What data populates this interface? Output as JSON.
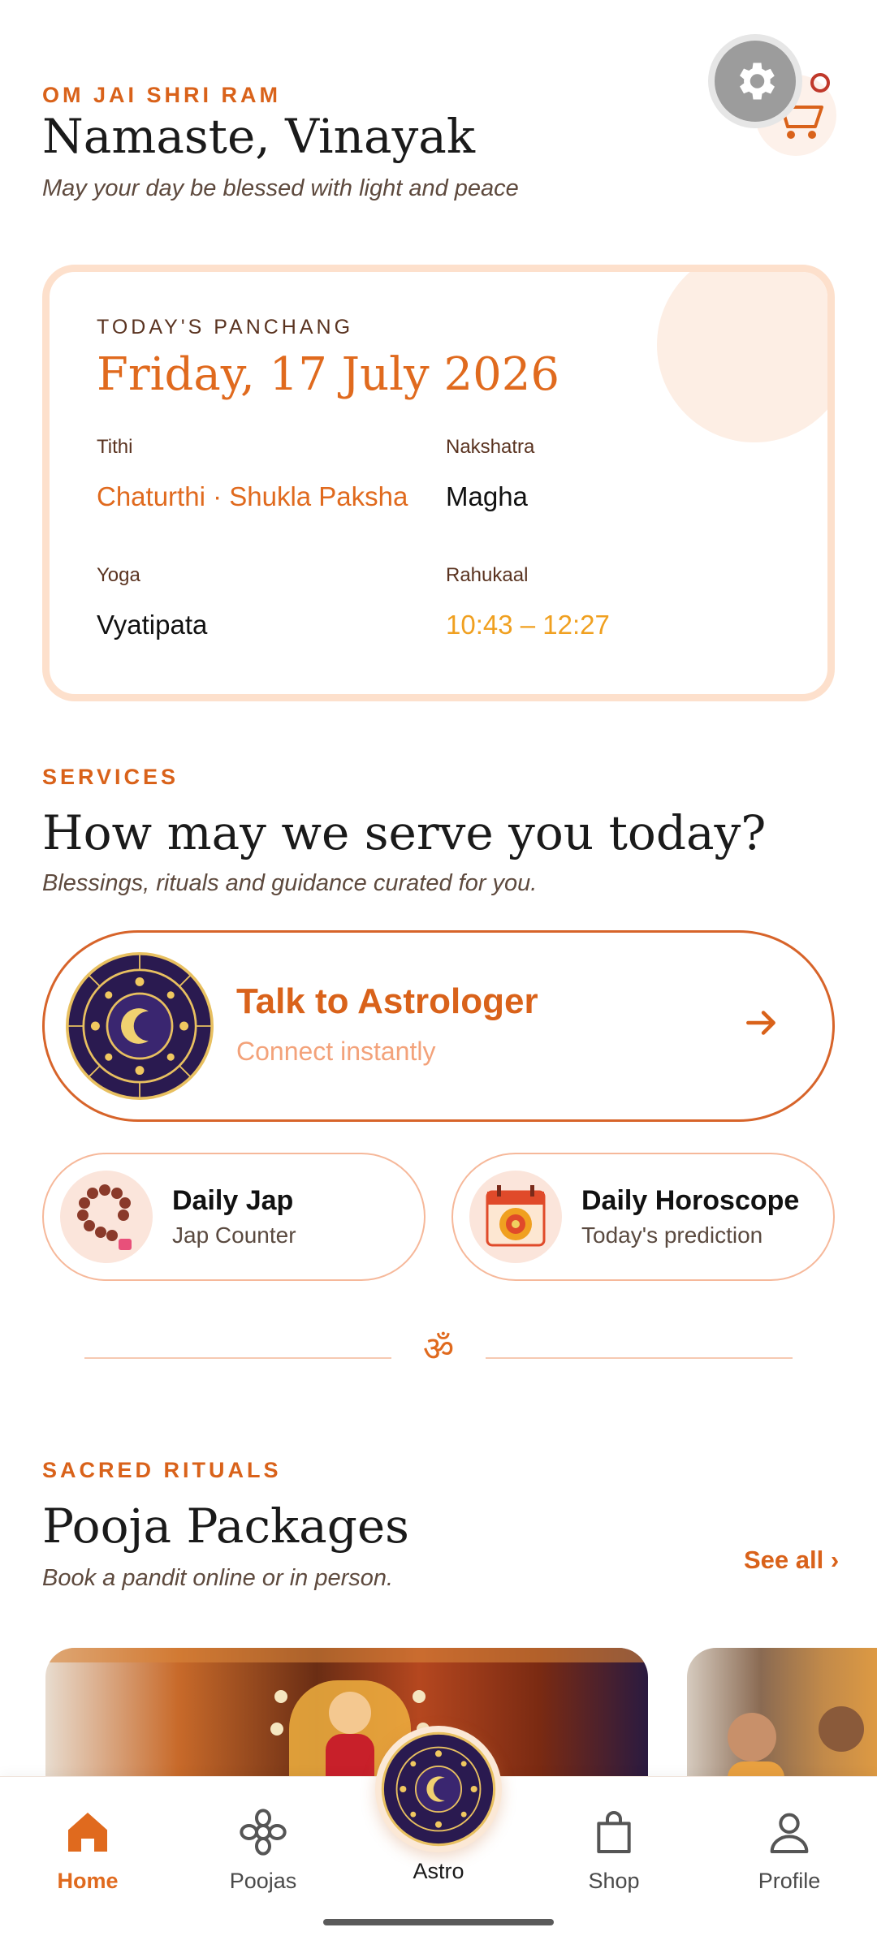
{
  "header": {
    "eyebrow": "OM JAI SHRI RAM",
    "greeting": "Namaste, Vinayak",
    "subtitle": "May your day be blessed with light and peace",
    "settings_icon": "gear-icon",
    "cart_icon": "cart-icon"
  },
  "panchang": {
    "label": "TODAY'S PANCHANG",
    "date": "Friday, 17 July 2026",
    "fields": [
      {
        "key": "Tithi",
        "value": "Chaturthi · Shukla Paksha"
      },
      {
        "key": "Nakshatra",
        "value": "Magha"
      },
      {
        "key": "Yoga",
        "value": "Vyatipata"
      },
      {
        "key": "Rahukaal",
        "value": "10:43 – 12:27"
      }
    ]
  },
  "services": {
    "eyebrow": "SERVICES",
    "title": "How may we serve you today?",
    "subtitle": "Blessings, rituals and guidance curated for you.",
    "astrologer": {
      "title": "Talk to Astrologer",
      "subtitle": "Connect instantly",
      "icon": "zodiac-wheel-icon"
    },
    "jap": {
      "title": "Daily Jap",
      "subtitle": "Jap Counter",
      "icon": "prayer-beads-icon"
    },
    "horoscope": {
      "title": "Daily Horoscope",
      "subtitle": "Today's prediction",
      "icon": "calendar-icon"
    },
    "divider_symbol": "ॐ"
  },
  "rituals": {
    "eyebrow": "SACRED RITUALS",
    "title": "Pooja Packages",
    "subtitle": "Book a pandit online or in person.",
    "see_all": "See all ›"
  },
  "nav": {
    "home": "Home",
    "poojas": "Poojas",
    "astro": "Astro",
    "shop": "Shop",
    "profile": "Profile"
  },
  "colors": {
    "accent": "#e06a1e",
    "gold": "#f0a020",
    "card_border": "#fde0cc"
  }
}
